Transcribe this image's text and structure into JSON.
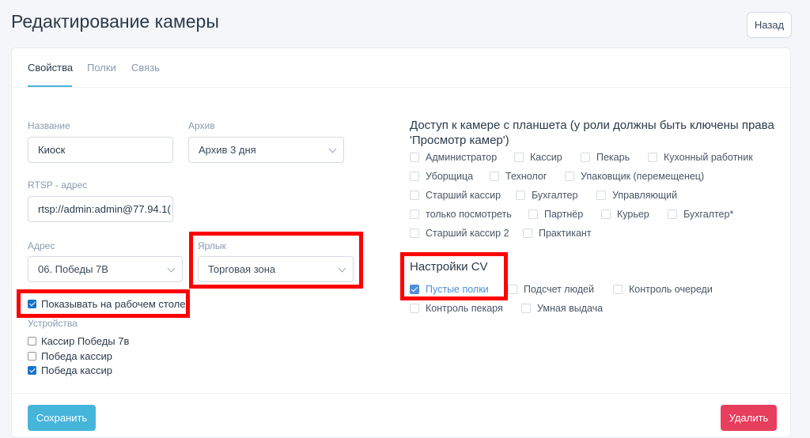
{
  "header": {
    "title": "Редактирование камеры",
    "back_label": "Назад"
  },
  "tabs": [
    {
      "label": "Свойства",
      "active": true
    },
    {
      "label": "Полки",
      "active": false
    },
    {
      "label": "Связь",
      "active": false
    }
  ],
  "form": {
    "name_label": "Название",
    "name_value": "Киоск",
    "archive_label": "Архив",
    "archive_value": "Архив 3 дня",
    "rtsp_label": "RTSP - адрес",
    "rtsp_value": "rtsp://admin:admin@77.94.1(",
    "address_label": "Адрес",
    "address_value": "06. Победы 7В",
    "shortcut_label": "Ярлык",
    "shortcut_value": "Торговая зона",
    "show_on_desktop_label": "Показывать на рабочем столе",
    "show_on_desktop_checked": true,
    "devices_label": "Устройства",
    "devices": [
      {
        "label": "Кассир Победы 7в",
        "checked": false
      },
      {
        "label": "Победа кассир",
        "checked": false
      },
      {
        "label": "Победа кассир",
        "checked": true
      }
    ]
  },
  "access": {
    "title": "Доступ к камере с планшета (у роли должны быть ключены права 'Просмотр камер')",
    "title_line1": "Доступ к камере с планшета (у роли должны быть ключены права",
    "title_line2": "'Просмотр камер')",
    "roles": [
      {
        "label": "Администратор",
        "checked": false
      },
      {
        "label": "Кассир",
        "checked": false
      },
      {
        "label": "Пекарь",
        "checked": false
      },
      {
        "label": "Кухонный работник",
        "checked": false
      },
      {
        "label": "Уборщица",
        "checked": false
      },
      {
        "label": "Технолог",
        "checked": false
      },
      {
        "label": "Упаковщик (перемещенец)",
        "checked": false
      },
      {
        "label": "Старший кассир",
        "checked": false
      },
      {
        "label": "Бухгалтер",
        "checked": false
      },
      {
        "label": "Управляющий",
        "checked": false
      },
      {
        "label": "только посмотреть",
        "checked": false
      },
      {
        "label": "Партнёр",
        "checked": false
      },
      {
        "label": "Курьер",
        "checked": false
      },
      {
        "label": "Бухгалтер*",
        "checked": false
      },
      {
        "label": "Старший кассир 2",
        "checked": false
      },
      {
        "label": "Практикант",
        "checked": false
      }
    ]
  },
  "cv": {
    "title": "Настройки CV",
    "options": [
      {
        "label": "Пустые полки",
        "checked": true
      },
      {
        "label": "Подсчет людей",
        "checked": false
      },
      {
        "label": "Контроль очереди",
        "checked": false
      },
      {
        "label": "Контроль пекаря",
        "checked": false
      },
      {
        "label": "Умная выдача",
        "checked": false
      }
    ]
  },
  "footer": {
    "save_label": "Сохранить",
    "delete_label": "Удалить"
  },
  "colors": {
    "accent": "#45b5d9",
    "danger": "#e63e5c",
    "highlight": "#ff0000"
  }
}
